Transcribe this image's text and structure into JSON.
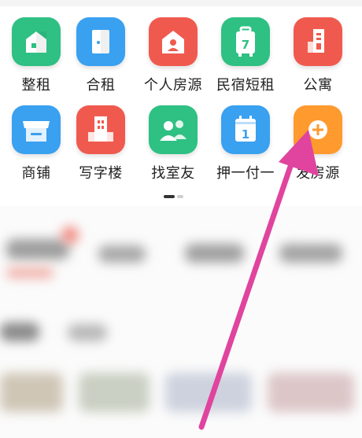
{
  "row1": [
    {
      "label": "整租",
      "icon": "house-icon",
      "color": "#2fc083"
    },
    {
      "label": "合租",
      "icon": "door-icon",
      "color": "#3aa0f0"
    },
    {
      "label": "个人房源",
      "icon": "person-house-icon",
      "color": "#f05a4e"
    },
    {
      "label": "民宿短租",
      "icon": "calendar-suitcase-icon",
      "color": "#2fc083"
    },
    {
      "label": "公寓",
      "icon": "apartment-icon",
      "color": "#f05a4e"
    }
  ],
  "row2": [
    {
      "label": "商铺",
      "icon": "shop-icon",
      "color": "#3aa0f0"
    },
    {
      "label": "写字楼",
      "icon": "office-building-icon",
      "color": "#f05a4e"
    },
    {
      "label": "找室友",
      "icon": "roommate-icon",
      "color": "#2fc083"
    },
    {
      "label": "押一付一",
      "icon": "calendar-one-icon",
      "color": "#3aa0f0"
    },
    {
      "label": "发房源",
      "icon": "plus-icon",
      "color": "#ff9a2e"
    }
  ],
  "calendar_day": "7",
  "calendar_one": "1",
  "annotation_arrow_color": "#e0449e"
}
